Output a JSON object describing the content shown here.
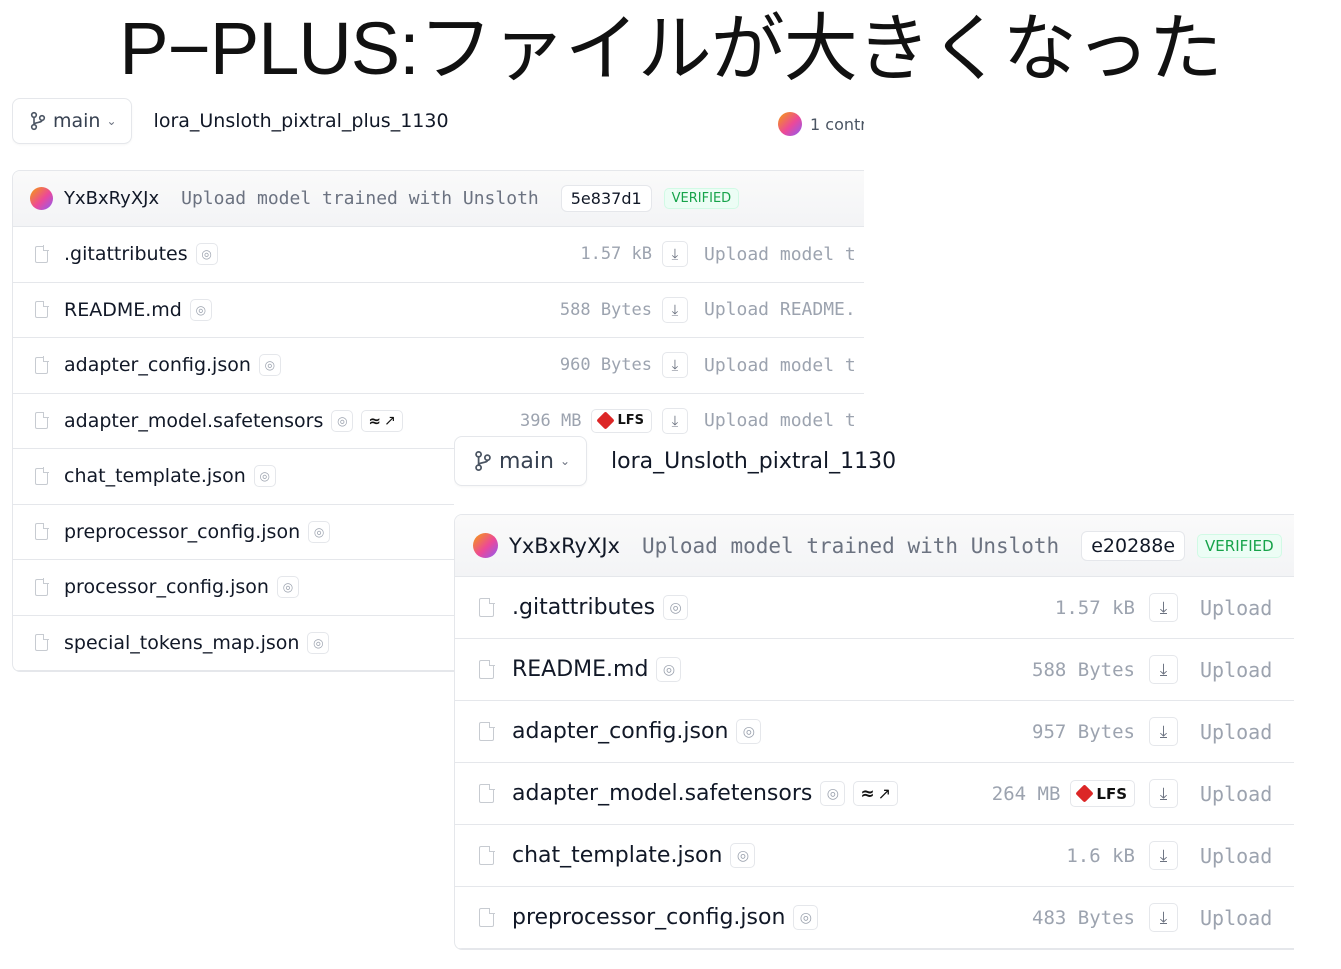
{
  "title": "P−PLUS:ファイルが大きくなった",
  "icons": {
    "branch": "git-branch-icon",
    "chevron": "chevron-down-icon",
    "file": "file-icon",
    "scan": "security-scan-icon",
    "xet": "xet-storage-icon",
    "download": "download-icon",
    "lfs": "lfs-icon"
  },
  "colors": {
    "verified": "#16a34a",
    "lfs_cube": "#dc2626",
    "muted": "#9ca3af"
  },
  "repo_plus": {
    "branch": "main",
    "repo_name": "lora_Unsloth_pixtral_plus_1130",
    "contributors": "1 contri",
    "commit": {
      "author": "YxBxRyXJx",
      "message": "Upload model trained with Unsloth",
      "hash": "5e837d1",
      "verified": "VERIFIED"
    },
    "files": [
      {
        "name": ".gitattributes",
        "size": "1.57 kB",
        "commit_msg": "Upload model t"
      },
      {
        "name": "README.md",
        "size": "588 Bytes",
        "commit_msg": "Upload README."
      },
      {
        "name": "adapter_config.json",
        "size": "960 Bytes",
        "commit_msg": "Upload model t"
      },
      {
        "name": "adapter_model.safetensors",
        "size": "396 MB",
        "lfs": "LFS",
        "xet": "↗",
        "commit_msg": "Upload model t"
      },
      {
        "name": "chat_template.json"
      },
      {
        "name": "preprocessor_config.json"
      },
      {
        "name": "processor_config.json"
      },
      {
        "name": "special_tokens_map.json"
      }
    ]
  },
  "repo_base": {
    "branch": "main",
    "repo_name": "lora_Unsloth_pixtral_1130",
    "commit": {
      "author": "YxBxRyXJx",
      "message": "Upload model trained with Unsloth",
      "hash": "e20288e",
      "verified": "VERIFIED"
    },
    "files": [
      {
        "name": ".gitattributes",
        "size": "1.57 kB",
        "commit_msg": "Upload"
      },
      {
        "name": "README.md",
        "size": "588 Bytes",
        "commit_msg": "Upload"
      },
      {
        "name": "adapter_config.json",
        "size": "957 Bytes",
        "commit_msg": "Upload"
      },
      {
        "name": "adapter_model.safetensors",
        "size": "264 MB",
        "lfs": "LFS",
        "xet": "↗",
        "commit_msg": "Upload"
      },
      {
        "name": "chat_template.json",
        "size": "1.6 kB",
        "commit_msg": "Upload"
      },
      {
        "name": "preprocessor_config.json",
        "size": "483 Bytes",
        "commit_msg": "Upload"
      }
    ]
  }
}
